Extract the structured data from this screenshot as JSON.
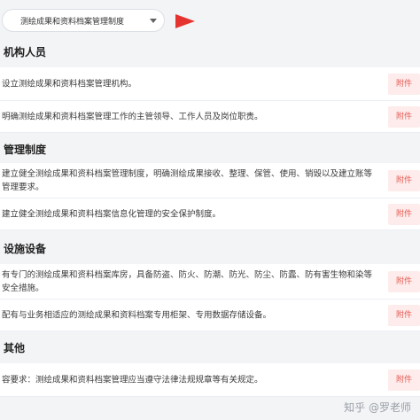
{
  "filter": {
    "selected": "测绘成果和资料档案管理制度"
  },
  "sections": [
    {
      "title": "机构人员",
      "rows": [
        {
          "text": "设立测绘成果和资料档案管理机构。",
          "button": "附件"
        },
        {
          "text": "明确测绘成果和资料档案管理工作的主管领导、工作人员及岗位职责。",
          "button": "附件"
        }
      ]
    },
    {
      "title": "管理制度",
      "rows": [
        {
          "text": "建立健全测绘成果和资料档案管理制度，明确测绘成果接收、整理、保管、使用、销毁以及建立账等管理要求。",
          "button": "附件"
        },
        {
          "text": "建立健全测绘成果和资料档案信息化管理的安全保护制度。",
          "button": "附件"
        }
      ]
    },
    {
      "title": "设施设备",
      "rows": [
        {
          "text": "有专门的测绘成果和资料档案库房，具备防盗、防火、防潮、防光、防尘、防蠹、防有害生物和染等安全措施。",
          "button": "附件"
        },
        {
          "text": "配有与业务相适应的测绘成果和资料档案专用柜架、专用数据存储设备。",
          "button": "附件"
        }
      ]
    },
    {
      "title": "其他",
      "rows": [
        {
          "text": "容要求：测绘成果和资料档案管理应当遵守法律法规规章等有关规定。",
          "button": "附件"
        }
      ]
    }
  ],
  "watermark": "知乎 @罗老师",
  "colors": {
    "accent": "#e5342f",
    "attach_bg": "#fdeceb",
    "attach_text": "#e55b55"
  }
}
